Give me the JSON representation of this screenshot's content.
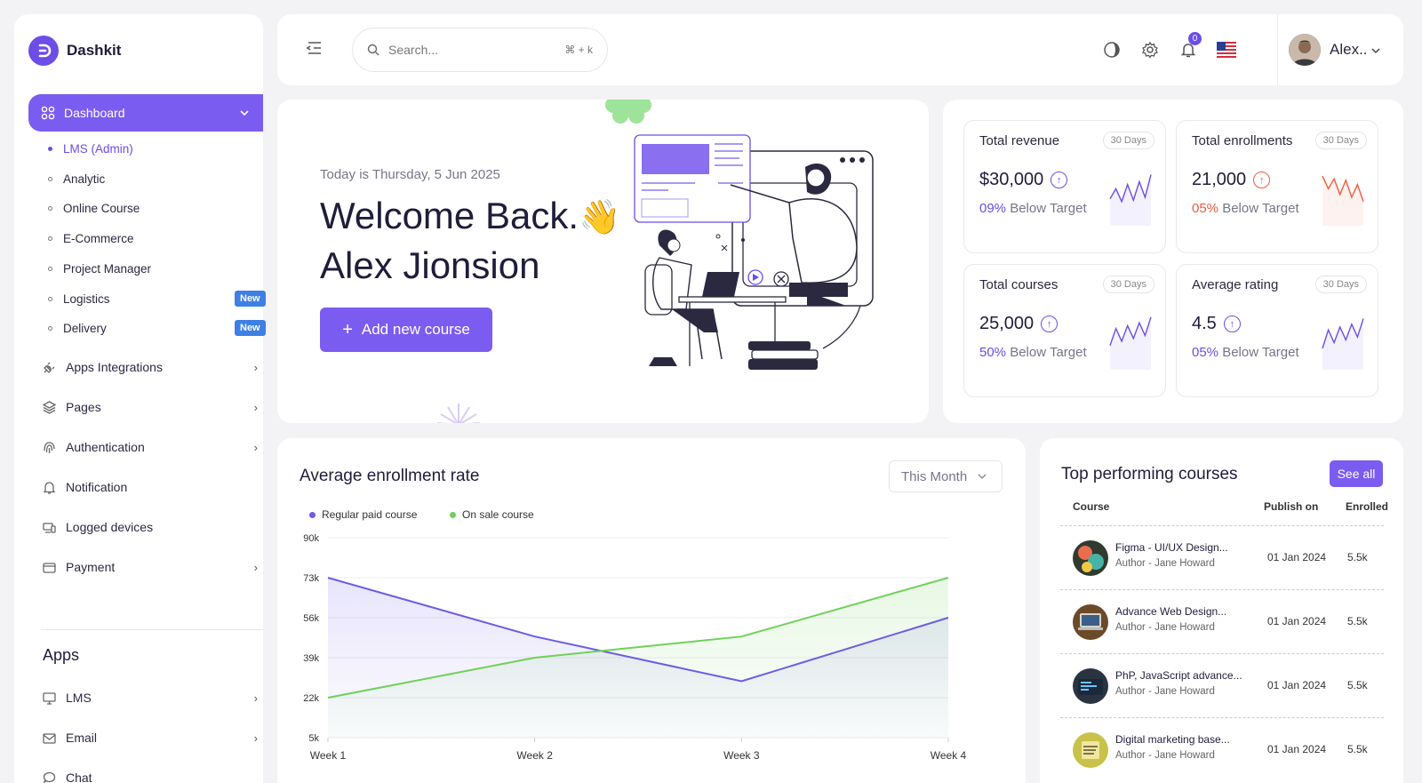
{
  "app": {
    "name": "Dashkit"
  },
  "sidebar": {
    "dashboard_label": "Dashboard",
    "subitems": [
      {
        "label": "LMS (Admin)"
      },
      {
        "label": "Analytic"
      },
      {
        "label": "Online Course"
      },
      {
        "label": "E-Commerce"
      },
      {
        "label": "Project Manager"
      },
      {
        "label": "Logistics",
        "badge": "New"
      },
      {
        "label": "Delivery",
        "badge": "New"
      }
    ],
    "items": [
      {
        "label": "Apps Integrations",
        "icon": "plug-icon"
      },
      {
        "label": "Pages",
        "icon": "layers-icon"
      },
      {
        "label": "Authentication",
        "icon": "fingerprint-icon"
      },
      {
        "label": "Notification",
        "icon": "bell-icon"
      },
      {
        "label": "Logged devices",
        "icon": "devices-icon"
      },
      {
        "label": "Payment",
        "icon": "wallet-icon"
      }
    ],
    "apps_title": "Apps",
    "apps": [
      {
        "label": "LMS",
        "icon": "monitor-icon"
      },
      {
        "label": "Email",
        "icon": "mail-icon"
      },
      {
        "label": "Chat",
        "icon": "chat-icon"
      }
    ]
  },
  "topbar": {
    "search_placeholder": "Search...",
    "search_shortcut": "⌘ + k",
    "notification_count": "0",
    "user_name": "Alex.."
  },
  "welcome": {
    "date_text": "Today is Thursday, 5 Jun 2025",
    "line1": "Welcome Back.",
    "emoji": "👋",
    "line2": "Alex Jionsion",
    "button_label": "Add new course"
  },
  "stats": [
    {
      "title": "Total revenue",
      "period": "30 Days",
      "value": "$30,000",
      "percent": "09%",
      "note": "Below Target",
      "color": "#6c4de6",
      "trend": [
        38,
        52,
        34,
        58,
        36,
        62,
        40,
        72
      ]
    },
    {
      "title": "Total enrollments",
      "period": "30 Days",
      "value": "21,000",
      "percent": "05%",
      "note": "Below Target",
      "color": "#f05a3a",
      "trend": [
        70,
        52,
        66,
        44,
        64,
        40,
        58,
        34
      ]
    },
    {
      "title": "Total courses",
      "period": "30 Days",
      "value": "25,000",
      "percent": "50%",
      "note": "Below Target",
      "color": "#6c4de6",
      "trend": [
        34,
        58,
        40,
        62,
        44,
        66,
        48,
        74
      ]
    },
    {
      "title": "Average rating",
      "period": "30 Days",
      "value": "4.5",
      "percent": "05%",
      "note": "Below Target",
      "color": "#6c4de6",
      "trend": [
        30,
        56,
        38,
        60,
        42,
        64,
        46,
        72
      ]
    }
  ],
  "enrollment": {
    "title": "Average enrollment rate",
    "period_label": "This Month"
  },
  "chart_data": {
    "type": "area",
    "categories": [
      "Week 1",
      "Week 2",
      "Week 3",
      "Week 4"
    ],
    "y_ticks": [
      "90k",
      "73k",
      "56k",
      "39k",
      "22k",
      "5k"
    ],
    "ylim": [
      5000,
      90000
    ],
    "grid": true,
    "legend_position": "top-left",
    "series": [
      {
        "name": "Regular paid course",
        "color": "#6c5ce7",
        "values": [
          73000,
          48000,
          29000,
          56000
        ]
      },
      {
        "name": "On sale course",
        "color": "#6fd15a",
        "values": [
          22000,
          39000,
          48000,
          73000
        ]
      }
    ]
  },
  "top_courses": {
    "title": "Top performing courses",
    "see_all": "See all",
    "headers": {
      "course": "Course",
      "publish": "Publish on",
      "enrolled": "Enrolled"
    },
    "rows": [
      {
        "name": "Figma - UI/UX Design...",
        "author": "Author - Jane Howard",
        "date": "01 Jan 2024",
        "enrolled": "5.5k",
        "thumb": "#2f3b2f"
      },
      {
        "name": "Advance Web Design...",
        "author": "Author - Jane Howard",
        "date": "01 Jan 2024",
        "enrolled": "5.5k",
        "thumb": "#6b4a2a"
      },
      {
        "name": "PhP, JavaScript advance...",
        "author": "Author - Jane Howard",
        "date": "01 Jan 2024",
        "enrolled": "5.5k",
        "thumb": "#2a3340"
      },
      {
        "name": "Digital marketing base...",
        "author": "Author - Jane Howard",
        "date": "01 Jan 2024",
        "enrolled": "5.5k",
        "thumb": "#c8c24a"
      }
    ]
  }
}
